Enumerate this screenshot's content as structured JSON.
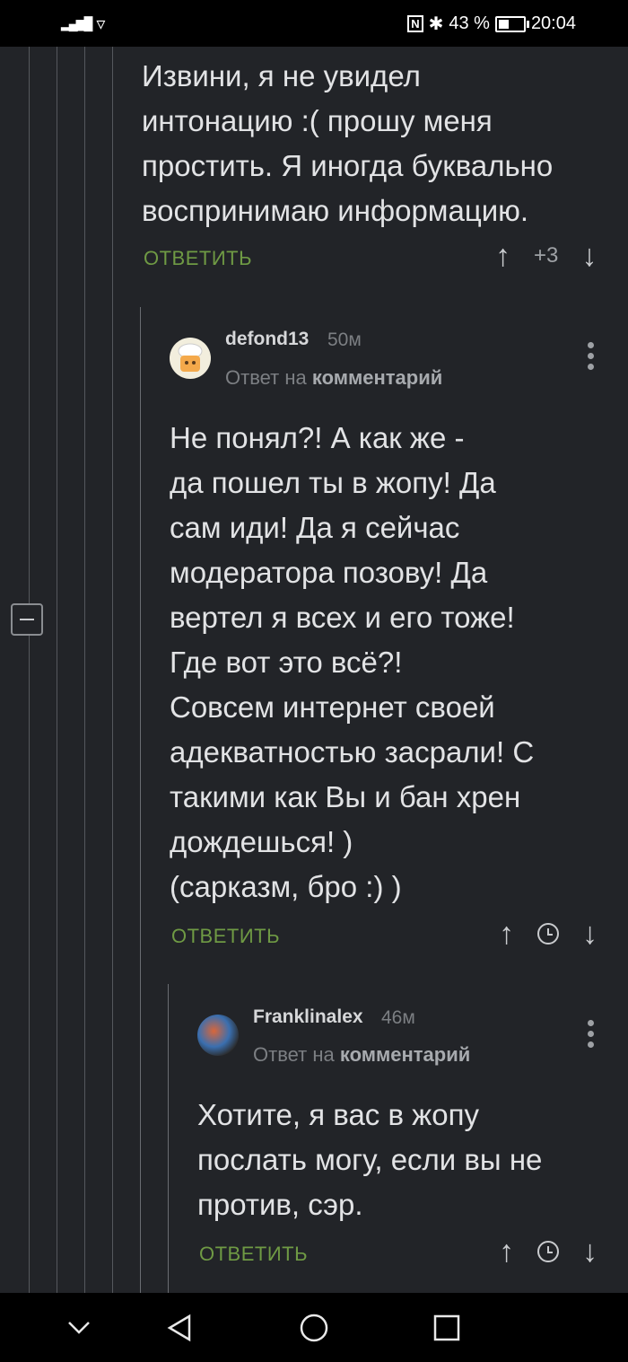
{
  "status": {
    "signal": "▂▄▆█",
    "wifi": "▿",
    "nfc": "N",
    "bluetooth": "✱",
    "battery_percent": "43 %",
    "battery_level": 0.43,
    "time": "20:04"
  },
  "comments": [
    {
      "text": "Извини, я не увидел\nинтонацию :( прошу меня\nпростить. Я иногда буквально\nвоспринимаю информацию.",
      "reply_label": "ОТВЕТИТЬ",
      "score": "+3"
    },
    {
      "username": "defond13",
      "time": "50м",
      "reply_to_prefix": "Ответ на",
      "reply_to_link": "комментарий",
      "text": "Не понял?! А как же -\nда пошел ты в жопу! Да\nсам иди! Да я сейчас\nмодератора позову! Да\nвертел я всех и его тоже!\nГде вот это всё?!\nСовсем интернет своей\nадекватностью засрали! С\nтакими как Вы и бан хрен\nдождешься! )\n(сарказм, бро :) )",
      "reply_label": "ОТВЕТИТЬ"
    },
    {
      "username": "Franklinalex",
      "time": "46м",
      "reply_to_prefix": "Ответ на",
      "reply_to_link": "комментарий",
      "text": "Хотите, я вас в жопу\nпослать могу, если вы не\nпротив, сэр.",
      "reply_label": "ОТВЕТИТЬ"
    }
  ],
  "icons": {
    "up": "↑",
    "down": "↓",
    "nav_down": "⌄"
  },
  "colors": {
    "background": "#222428",
    "accent_green": "#6f9a44"
  }
}
